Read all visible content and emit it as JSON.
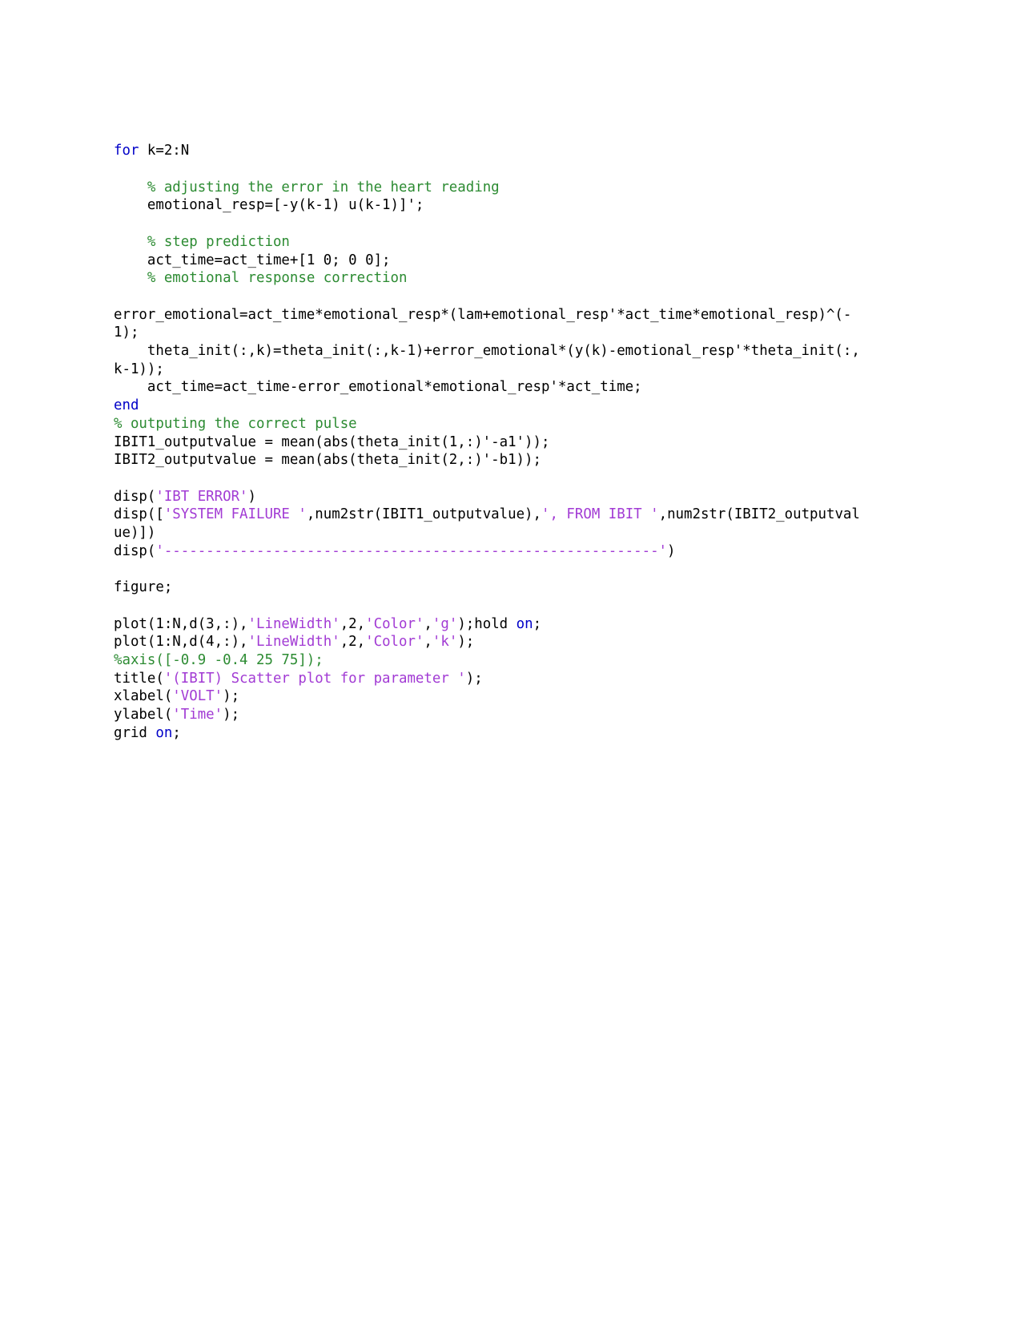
{
  "document": {
    "type": "code-listing",
    "language": "MATLAB",
    "page_background": "#ffffff",
    "colors": {
      "keyword": "#0000c8",
      "comment": "#2c8b32",
      "string": "#a23bd4",
      "plain": "#000000"
    },
    "lines": [
      {
        "id": "l01",
        "segments": [
          {
            "c": "kw",
            "t": "for"
          },
          {
            "c": "pl",
            "t": " k=2:N"
          }
        ]
      },
      {
        "id": "l02",
        "segments": []
      },
      {
        "id": "l03",
        "segments": [
          {
            "c": "cm",
            "t": "    % adjusting the error in the heart reading"
          }
        ]
      },
      {
        "id": "l04",
        "segments": [
          {
            "c": "pl",
            "t": "    emotional_resp=[-y(k-1) u(k-1)]';"
          }
        ]
      },
      {
        "id": "l05",
        "segments": []
      },
      {
        "id": "l06",
        "segments": [
          {
            "c": "cm",
            "t": "    % step prediction"
          }
        ]
      },
      {
        "id": "l07",
        "segments": [
          {
            "c": "pl",
            "t": "    act_time=act_time+[1 0; 0 0];"
          }
        ]
      },
      {
        "id": "l08",
        "segments": [
          {
            "c": "cm",
            "t": "    % emotional response correction"
          }
        ]
      },
      {
        "id": "l09",
        "segments": []
      },
      {
        "id": "l10",
        "segments": [
          {
            "c": "pl",
            "t": "error_emotional=act_time*emotional_resp*(lam+emotional_resp'*act_time*emotional_resp)^(-1);"
          }
        ]
      },
      {
        "id": "l11",
        "segments": [
          {
            "c": "pl",
            "t": "    theta_init(:,k)=theta_init(:,k-1)+error_emotional*(y(k)-emotional_resp'*theta_init(:,k-1));"
          }
        ]
      },
      {
        "id": "l12",
        "segments": [
          {
            "c": "pl",
            "t": "    act_time=act_time-error_emotional*emotional_resp'*act_time;"
          }
        ]
      },
      {
        "id": "l13",
        "segments": [
          {
            "c": "kw",
            "t": "end"
          }
        ]
      },
      {
        "id": "l14",
        "segments": [
          {
            "c": "cm",
            "t": "% outputing the correct pulse"
          }
        ]
      },
      {
        "id": "l15",
        "segments": [
          {
            "c": "pl",
            "t": "IBIT1_outputvalue = mean(abs(theta_init(1,:)'-a1'));"
          }
        ]
      },
      {
        "id": "l16",
        "segments": [
          {
            "c": "pl",
            "t": "IBIT2_outputvalue = mean(abs(theta_init(2,:)'-b1));"
          }
        ]
      },
      {
        "id": "l17",
        "segments": []
      },
      {
        "id": "l18",
        "segments": [
          {
            "c": "pl",
            "t": "disp("
          },
          {
            "c": "str",
            "t": "'IBT ERROR'"
          },
          {
            "c": "pl",
            "t": ")"
          }
        ]
      },
      {
        "id": "l19",
        "segments": [
          {
            "c": "pl",
            "t": "disp(["
          },
          {
            "c": "str",
            "t": "'SYSTEM FAILURE '"
          },
          {
            "c": "pl",
            "t": ",num2str(IBIT1_outputvalue),"
          },
          {
            "c": "str",
            "t": "', FROM IBIT '"
          },
          {
            "c": "pl",
            "t": ",num2str(IBIT2_outputvalue)])"
          }
        ]
      },
      {
        "id": "l20",
        "segments": [
          {
            "c": "pl",
            "t": "disp("
          },
          {
            "c": "str",
            "t": "'-----------------------------------------------------------'"
          },
          {
            "c": "pl",
            "t": ")"
          }
        ]
      },
      {
        "id": "l21",
        "segments": []
      },
      {
        "id": "l22",
        "segments": [
          {
            "c": "pl",
            "t": "figure;"
          }
        ]
      },
      {
        "id": "l23",
        "segments": []
      },
      {
        "id": "l24",
        "segments": [
          {
            "c": "pl",
            "t": "plot(1:N,d(3,:),"
          },
          {
            "c": "str",
            "t": "'LineWidth'"
          },
          {
            "c": "pl",
            "t": ",2,"
          },
          {
            "c": "str",
            "t": "'Color'"
          },
          {
            "c": "pl",
            "t": ","
          },
          {
            "c": "str",
            "t": "'g'"
          },
          {
            "c": "pl",
            "t": ");hold "
          },
          {
            "c": "kw",
            "t": "on"
          },
          {
            "c": "pl",
            "t": ";"
          }
        ]
      },
      {
        "id": "l25",
        "segments": [
          {
            "c": "pl",
            "t": "plot(1:N,d(4,:),"
          },
          {
            "c": "str",
            "t": "'LineWidth'"
          },
          {
            "c": "pl",
            "t": ",2,"
          },
          {
            "c": "str",
            "t": "'Color'"
          },
          {
            "c": "pl",
            "t": ","
          },
          {
            "c": "str",
            "t": "'k'"
          },
          {
            "c": "pl",
            "t": ");"
          }
        ]
      },
      {
        "id": "l26",
        "segments": [
          {
            "c": "cm",
            "t": "%axis([-0.9 -0.4 25 75]);"
          }
        ]
      },
      {
        "id": "l27",
        "segments": [
          {
            "c": "pl",
            "t": "title("
          },
          {
            "c": "str",
            "t": "'(IBIT) Scatter plot for parameter '"
          },
          {
            "c": "pl",
            "t": ");"
          }
        ]
      },
      {
        "id": "l28",
        "segments": [
          {
            "c": "pl",
            "t": "xlabel("
          },
          {
            "c": "str",
            "t": "'VOLT'"
          },
          {
            "c": "pl",
            "t": ");"
          }
        ]
      },
      {
        "id": "l29",
        "segments": [
          {
            "c": "pl",
            "t": "ylabel("
          },
          {
            "c": "str",
            "t": "'Time'"
          },
          {
            "c": "pl",
            "t": ");"
          }
        ]
      },
      {
        "id": "l30",
        "segments": [
          {
            "c": "pl",
            "t": "grid "
          },
          {
            "c": "kw",
            "t": "on"
          },
          {
            "c": "pl",
            "t": ";"
          }
        ]
      }
    ]
  }
}
